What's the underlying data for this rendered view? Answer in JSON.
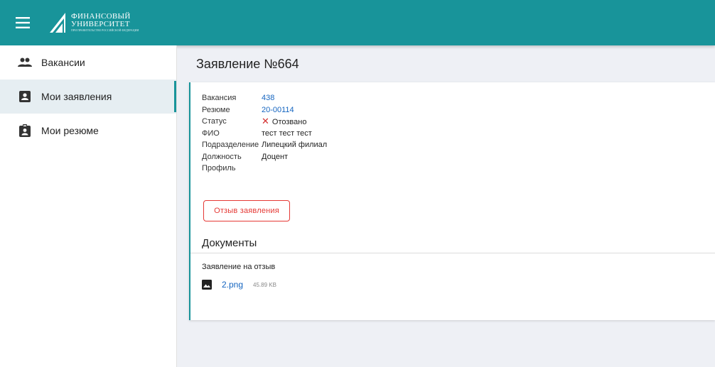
{
  "header": {
    "logo_line1": "ФИНАНСОВЫЙ",
    "logo_line2": "УНИВЕРСИТЕТ",
    "logo_line3": "ПРИ ПРАВИТЕЛЬСТВЕ РОССИЙСКОЙ ФЕДЕРАЦИИ",
    "menu_icon": "menu-icon"
  },
  "sidebar": {
    "items": [
      {
        "label": "Вакансии",
        "icon": "people-icon"
      },
      {
        "label": "Мои заявления",
        "icon": "person-card-icon",
        "active": true
      },
      {
        "label": "Мои резюме",
        "icon": "clipboard-person-icon"
      }
    ]
  },
  "main": {
    "title": "Заявление №664",
    "fields": [
      {
        "key": "Вакансия",
        "value": "438"
      },
      {
        "key": "Резюме",
        "value": "20-00114"
      },
      {
        "key": "Статус",
        "value": "Отозвано"
      },
      {
        "key": "ФИО",
        "value": "тест тест тест"
      },
      {
        "key": "Подразделение",
        "value": "Липецкий филиал"
      },
      {
        "key": "Должность",
        "value": "Доцент"
      },
      {
        "key": "Профиль",
        "value": ""
      }
    ],
    "revoke_button": "Отзыв заявления",
    "documents_title": "Документы",
    "documents_subtitle": "Заявление на отзыв",
    "file": {
      "name": "2.png",
      "size": "45.89 KB",
      "icon": "image-icon"
    }
  },
  "colors": {
    "accent": "#18949a",
    "danger": "#e53935",
    "link": "#1565c0"
  }
}
